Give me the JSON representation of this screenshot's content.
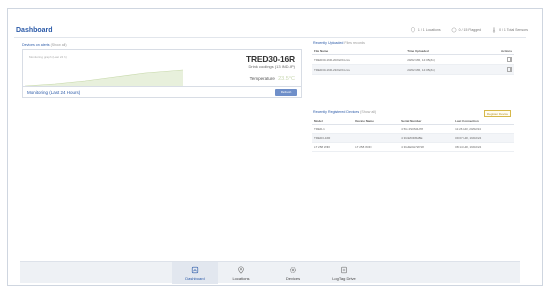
{
  "header": {
    "title": "Dashboard",
    "stats": [
      {
        "icon": "location-pin-icon",
        "label": "1 / 1 Locations"
      },
      {
        "icon": "circle-icon",
        "label": "0 / 15 Flagged"
      },
      {
        "icon": "thermometer-icon",
        "label": "0 / 1 Total Sensors"
      }
    ]
  },
  "device_card": {
    "section_title": "Devices on alerts",
    "section_sub": "(Show all)",
    "chart_label": "Monitoring graph (Last 24 h)",
    "device_name": "TRED30-16R",
    "device_desc": "Drink coolings (13 IND-IP)",
    "temp_label": "Temperature",
    "temp_value": "23.5°C",
    "monitor_label": "Monitoring (Last 24 Hours)",
    "monitor_button": "Refresh"
  },
  "requests": {
    "title": "Recently Uploaded",
    "sub": "Files records",
    "columns": [
      "File Name",
      "Time Uploaded",
      "Actions"
    ],
    "rows": [
      {
        "file": "TRED30-16R-20/02/24.csv",
        "time": "20/02 MR, 14:05(Zn)"
      },
      {
        "file": "TRED30-16R-23/02/24.csv",
        "time": "23/02 MR, 14:05(Zn)"
      }
    ]
  },
  "registered": {
    "title": "Recently Registered Devices",
    "sub": "(Show all)",
    "register_button": "Register Device",
    "columns": [
      "Model",
      "Device Name",
      "Serial Number",
      "Last Connection"
    ],
    "rows": [
      {
        "model": "TRED-1",
        "name": "",
        "serial": "4 5G 2S0S0H78",
        "last": "11:26 HR, 20/02/24"
      },
      {
        "model": "TRED3-16R",
        "name": "",
        "serial": "4 3G9Z0D8H8E",
        "last": "09:07 HR, 19/02/24"
      },
      {
        "model": "LT 258 WIFI",
        "name": "LT 258 WIFI",
        "serial": "4 3G4E0H72P18",
        "last": "08:14 HR, 19/02/24"
      }
    ]
  },
  "nav": {
    "items": [
      {
        "icon": "dashboard-icon",
        "label": "Dashboard"
      },
      {
        "icon": "location-pin-icon",
        "label": "Locations"
      },
      {
        "icon": "gear-icon",
        "label": "Devices"
      },
      {
        "icon": "document-icon",
        "label": "LogTag Drive"
      }
    ]
  }
}
